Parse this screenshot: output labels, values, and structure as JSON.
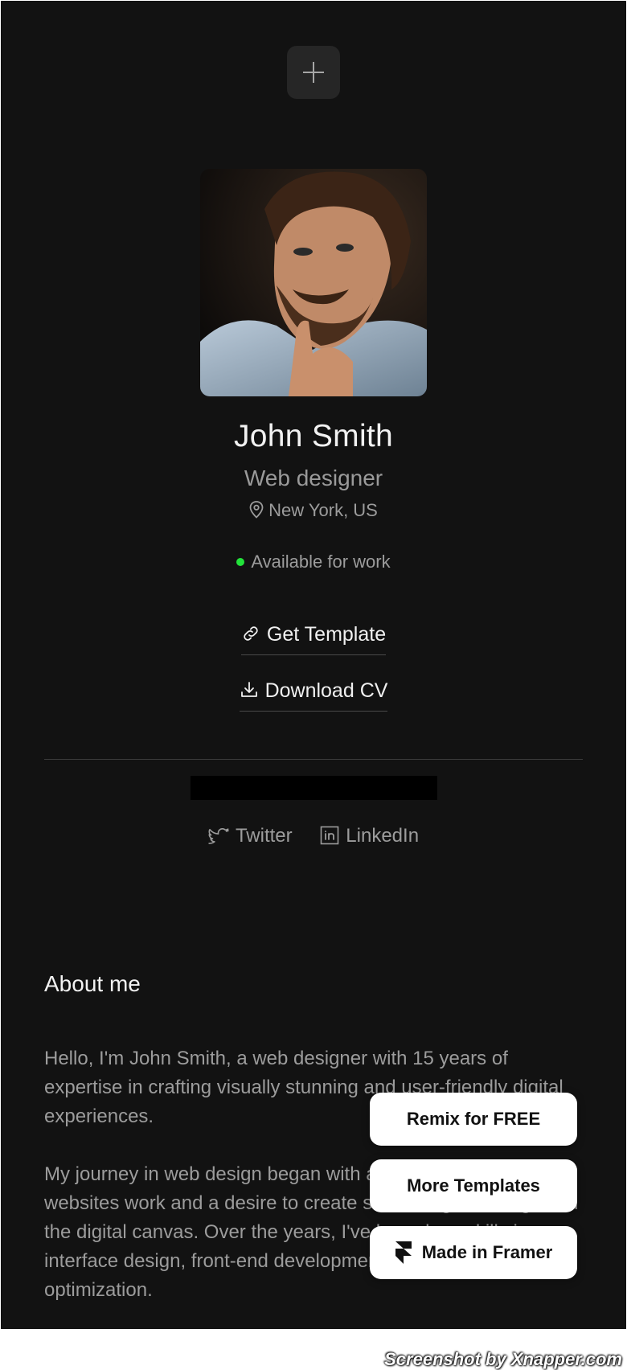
{
  "profile": {
    "name": "John Smith",
    "role": "Web designer",
    "location": "New York, US",
    "availability": "Available for work",
    "availability_color": "#22e33a"
  },
  "actions": {
    "get_template": "Get Template",
    "download_cv": "Download CV"
  },
  "socials": {
    "twitter": "Twitter",
    "linkedin": "LinkedIn"
  },
  "about": {
    "title": "About me",
    "paragraphs": [
      "Hello, I'm John Smith, a web designer with 15 years of expertise in crafting visually stunning and user-friendly digital experiences.",
      "My journey in web design began with a fascination for how websites work and a desire to create something meaningful on the digital canvas. Over the years, I've honed my skills in user interface design, front-end development, and user experience optimization."
    ]
  },
  "framer": {
    "remix": "Remix for FREE",
    "more_templates": "More Templates",
    "made_in": "Made in Framer"
  },
  "watermark": "Screenshot by Xnapper.com",
  "icons": {
    "add": "plus-icon",
    "location": "map-pin-icon",
    "template": "link-icon",
    "cv": "download-icon",
    "twitter": "twitter-icon",
    "linkedin": "linkedin-icon",
    "framer": "framer-logo-icon"
  },
  "colors": {
    "background": "#121212",
    "text_primary": "#f2f2f2",
    "text_secondary": "#9c9c9c",
    "button_bg": "#ffffff"
  }
}
